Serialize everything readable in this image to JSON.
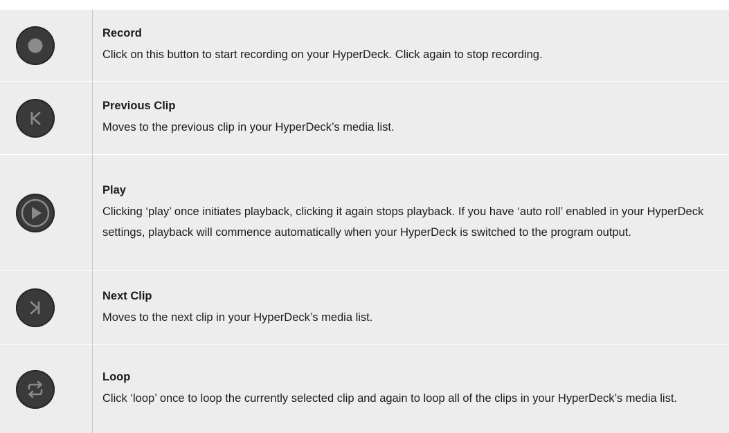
{
  "rows": [
    {
      "icon": "record-icon",
      "title": "Record",
      "description": "Click on this button to start recording on your HyperDeck. Click again to stop recording."
    },
    {
      "icon": "previous-clip-icon",
      "title": "Previous Clip",
      "description": "Moves to the previous clip in your HyperDeck’s media list."
    },
    {
      "icon": "play-icon",
      "title": "Play",
      "description": "Clicking ‘play’ once initiates playback, clicking it again stops playback. If you have ‘auto roll’ enabled in your HyperDeck settings, playback will commence automatically when your HyperDeck is switched to the program output."
    },
    {
      "icon": "next-clip-icon",
      "title": "Next Clip",
      "description": "Moves to the next clip in your HyperDeck’s media list."
    },
    {
      "icon": "loop-icon",
      "title": "Loop",
      "description": "Click ‘loop’ once to loop the currently selected clip and again to loop all of the clips in your HyperDeck’s media list."
    }
  ]
}
